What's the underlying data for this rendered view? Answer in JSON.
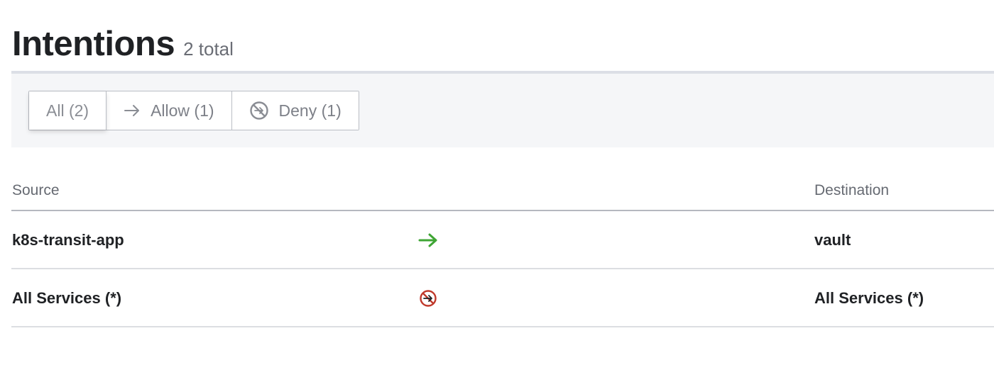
{
  "header": {
    "title": "Intentions",
    "count_text": "2 total"
  },
  "filters": [
    {
      "label": "All (2)",
      "icon": null,
      "active": true
    },
    {
      "label": "Allow (1)",
      "icon": "arrow-right-icon",
      "active": false
    },
    {
      "label": "Deny (1)",
      "icon": "deny-icon",
      "active": false
    }
  ],
  "table": {
    "columns": {
      "source": "Source",
      "destination": "Destination"
    },
    "rows": [
      {
        "source": "k8s-transit-app",
        "action": "allow",
        "action_icon": "allow-arrow-icon",
        "destination": "vault"
      },
      {
        "source": "All Services (*)",
        "action": "deny",
        "action_icon": "deny-icon",
        "destination": "All Services (*)"
      }
    ]
  },
  "colors": {
    "allow": "#3fa535",
    "deny": "#c0392b",
    "filter_bar_bg": "#f5f6f8",
    "text_primary": "#1f2124",
    "text_muted": "#6a6d75"
  }
}
